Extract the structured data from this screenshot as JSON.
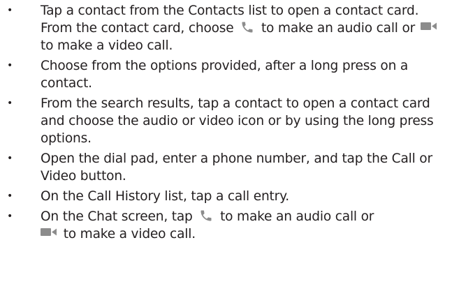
{
  "icons": {
    "phone": "phone-icon",
    "video": "video-camera-icon",
    "icon_color": "#8c8c8c"
  },
  "bullets": [
    {
      "t1": "Tap a contact from the Contacts list to open a contact card.  From the contact card, choose",
      "t2": "to make an audio call or",
      "t3": "to make a video call."
    },
    {
      "t1": "Choose from the options provided, after a long press on a contact."
    },
    {
      "t1": "From the search results, tap a contact to open a contact card and choose the audio or video icon or by using the long press options."
    },
    {
      "t1": "Open the dial pad, enter a phone number, and tap the Call or Video button."
    },
    {
      "t1": "On the Call History list, tap a call entry."
    },
    {
      "t1": "On the Chat screen, tap",
      "t2": "to make an audio call or",
      "t3": "to make a video call."
    }
  ]
}
